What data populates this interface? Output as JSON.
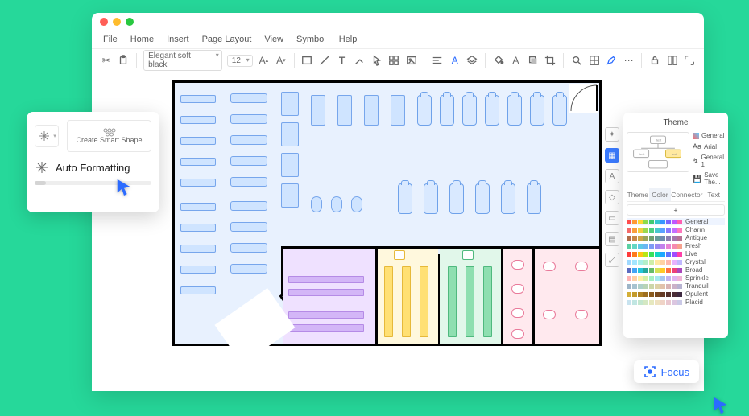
{
  "menus": {
    "file": "File",
    "home": "Home",
    "insert": "Insert",
    "page_layout": "Page Layout",
    "view": "View",
    "symbol": "Symbol",
    "help": "Help"
  },
  "toolbar": {
    "font_name": "Elegant soft black",
    "font_size": "12"
  },
  "callout": {
    "create_smart": "Create Smart Shape",
    "auto_formatting": "Auto Formatting"
  },
  "theme": {
    "title": "Theme",
    "side": {
      "general": "General",
      "font": "Arial",
      "g1": "General 1",
      "save": "Save The..."
    },
    "tabs": {
      "theme": "Theme",
      "color": "Color",
      "connector": "Connector",
      "text": "Text"
    },
    "palettes": [
      {
        "label": "General",
        "on": true,
        "c": [
          "#ff4d4d",
          "#ff9933",
          "#ffd633",
          "#8cdb4a",
          "#41c971",
          "#36c5cf",
          "#3797ff",
          "#7a65ff",
          "#c057ff",
          "#ff5fb0"
        ]
      },
      {
        "label": "Charm",
        "c": [
          "#f46a6a",
          "#f99e3d",
          "#f3cf3e",
          "#9bd94f",
          "#4fcf80",
          "#4ac8cf",
          "#5aa2ff",
          "#8a79ff",
          "#c36fff",
          "#ff77bd"
        ]
      },
      {
        "label": "Antique",
        "c": [
          "#b06c4a",
          "#c88848",
          "#cda646",
          "#9aa55a",
          "#6fa071",
          "#679b9a",
          "#6e8bb0",
          "#8a7eb0",
          "#a676ad",
          "#b57193"
        ]
      },
      {
        "label": "Fresh",
        "c": [
          "#5ad1a3",
          "#63d6c3",
          "#5ec9e6",
          "#6bb6f2",
          "#7e9cf5",
          "#9c8af2",
          "#c381ec",
          "#e984d4",
          "#f58bb0",
          "#f6a18d"
        ]
      },
      {
        "label": "Live",
        "c": [
          "#ff3b3b",
          "#ff7a1a",
          "#ffc414",
          "#b7e617",
          "#39e05c",
          "#11d4c4",
          "#1da8ff",
          "#5d73ff",
          "#a04dff",
          "#ff3fa8"
        ]
      },
      {
        "label": "Crystal",
        "c": [
          "#9fd9ff",
          "#a3e6ff",
          "#a8f0e9",
          "#b2efc9",
          "#cdeea8",
          "#ffe8a1",
          "#ffd1a3",
          "#ffb7ad",
          "#e7b2ff",
          "#c0b8ff"
        ]
      },
      {
        "label": "Broad",
        "c": [
          "#5c6bc0",
          "#42a5f5",
          "#26c6da",
          "#26a69a",
          "#66bb6a",
          "#d4e157",
          "#ffca28",
          "#ff7043",
          "#ec407a",
          "#ab47bc"
        ]
      },
      {
        "label": "Sprinkle",
        "c": [
          "#ffb3b3",
          "#ffd1a6",
          "#fff0a6",
          "#d7f0a6",
          "#a6f0c4",
          "#a6e9f0",
          "#a6c7f0",
          "#c0b3f0",
          "#e0b3f0",
          "#f0b3d7"
        ]
      },
      {
        "label": "Tranquil",
        "c": [
          "#9db5c8",
          "#a7c3cf",
          "#aed0c9",
          "#b8d4b6",
          "#cdd6a8",
          "#ded2a7",
          "#e1c2ab",
          "#d9b4b4",
          "#cbb2c9",
          "#b7b3d1"
        ]
      },
      {
        "label": "Opulent",
        "c": [
          "#d4af37",
          "#c49b2c",
          "#b28424",
          "#9e6e1f",
          "#8a5a1d",
          "#774920",
          "#653b25",
          "#55312c",
          "#4a2d36",
          "#3f2a41"
        ]
      },
      {
        "label": "Placid",
        "c": [
          "#c8e3ef",
          "#c1e6e2",
          "#c4e7cf",
          "#d4e8c3",
          "#e6e8be",
          "#efe1c0",
          "#efd3c6",
          "#e9c7cf",
          "#dbc6e0",
          "#cac9e6"
        ]
      }
    ]
  },
  "focus": {
    "label": "Focus"
  }
}
